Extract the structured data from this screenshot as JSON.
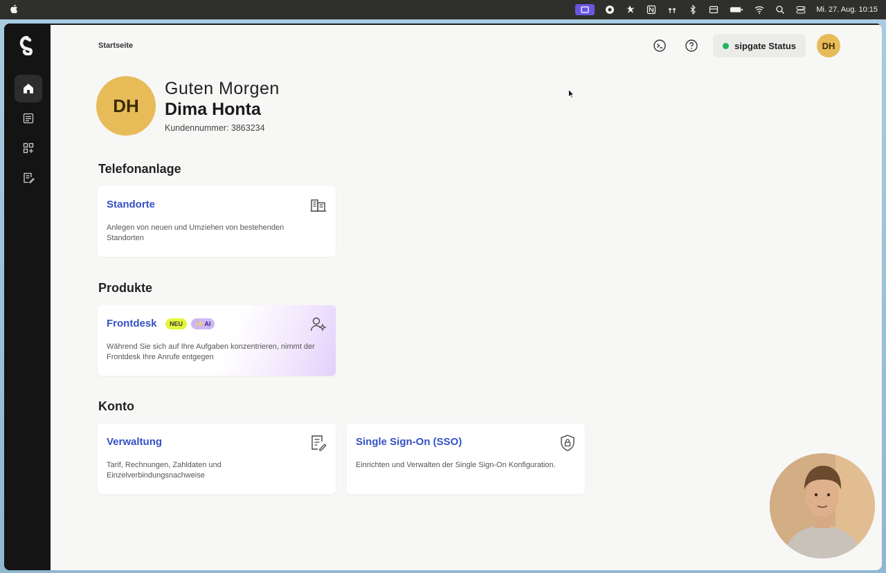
{
  "menubar": {
    "clock": "Mi. 27. Aug.  10:15"
  },
  "header": {
    "breadcrumb": "Startseite",
    "status_label": "sipgate Status",
    "avatar_initials": "DH"
  },
  "greeting": {
    "initials": "DH",
    "salutation": "Guten Morgen",
    "name": "Dima Honta",
    "customer_number": "Kundennummer: 3863234"
  },
  "sections": {
    "telefonanlage": {
      "title": "Telefonanlage",
      "standorte": {
        "title": "Standorte",
        "description": "Anlegen von neuen und Umziehen von bestehenden Standorten",
        "icon": "building-icon"
      }
    },
    "produkte": {
      "title": "Produkte",
      "frontdesk": {
        "title": "Frontdesk",
        "badge_new": "NEU",
        "badge_ai": "✨ AI",
        "description": "Während Sie sich auf Ihre Aufgaben konzentrieren, nimmt der Frontdesk Ihre Anrufe entgegen",
        "icon": "user-sparkle-icon"
      }
    },
    "konto": {
      "title": "Konto",
      "verwaltung": {
        "title": "Verwaltung",
        "description": "Tarif, Rechnungen, Zahldaten und Einzelverbindungsnachweise",
        "icon": "document-edit-icon"
      },
      "sso": {
        "title": "Single Sign-On (SSO)",
        "description": "Einrichten und Verwalten der Single Sign-On Konfiguration.",
        "icon": "shield-lock-icon"
      }
    }
  },
  "colors": {
    "accent_link": "#3451c4",
    "avatar": "#e8bb59",
    "status_ok": "#22b35e",
    "sidebar": "#141414",
    "badge_new": "#e5f53a",
    "badge_ai": "#cdb8f3"
  }
}
